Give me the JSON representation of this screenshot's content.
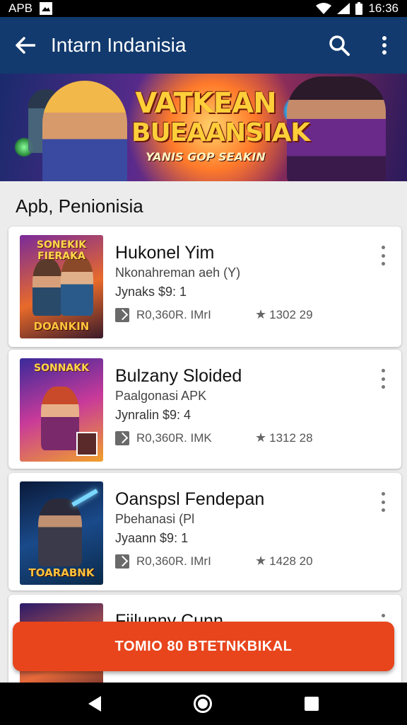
{
  "status_bar": {
    "left_text": "APB",
    "time": "16:36",
    "icons": [
      "image-icon",
      "wifi-icon",
      "signal-icon",
      "battery-icon"
    ]
  },
  "app_bar": {
    "title": "Intarn Indanisia",
    "back_icon": "arrow-left-icon",
    "search_icon": "search-icon",
    "menu_icon": "more-vert-icon"
  },
  "banner": {
    "line1": "VATKEAN",
    "line2": "BUEAANSIAK",
    "line3": "YANIS GOP SEAKIN"
  },
  "section": {
    "title": "Apb, Penionisia"
  },
  "apps": [
    {
      "name": "Hukonel Yim",
      "package": "Nkonahreman aeh (Y)",
      "version": "Jynaks $9: 1",
      "size": "R0,360R. IMrI",
      "rating": "1302 29",
      "thumb_title": "SONEKIK FIERAKA",
      "thumb_sub": "DOANKIN"
    },
    {
      "name": "Bulzany Sloided",
      "package": "Paalgonasi APK",
      "version": "Jynralin $9: 4",
      "size": "R0,360R. IMK",
      "rating": "1312 28",
      "thumb_title": "SONNAKK",
      "thumb_sub": ""
    },
    {
      "name": "Oanspsl Fendepan",
      "package": "Pbehanasi (Pl",
      "version": "Jyaann $9: 1",
      "size": "R0,360R. IMrI",
      "rating": "1428 20",
      "thumb_title": "",
      "thumb_sub": "TOARABNK"
    },
    {
      "name": "Fiilunny Cunn",
      "package": "",
      "version": "",
      "size": "",
      "rating": "",
      "thumb_title": "",
      "thumb_sub": ""
    }
  ],
  "cta": {
    "label": "TOMIO 80 BTETNKBIKAL"
  },
  "nav_bar": {
    "icons": [
      "nav-back-icon",
      "nav-home-icon",
      "nav-recents-icon"
    ]
  },
  "colors": {
    "app_bar": "#123a6e",
    "cta": "#e8451c",
    "background": "#ececec"
  }
}
